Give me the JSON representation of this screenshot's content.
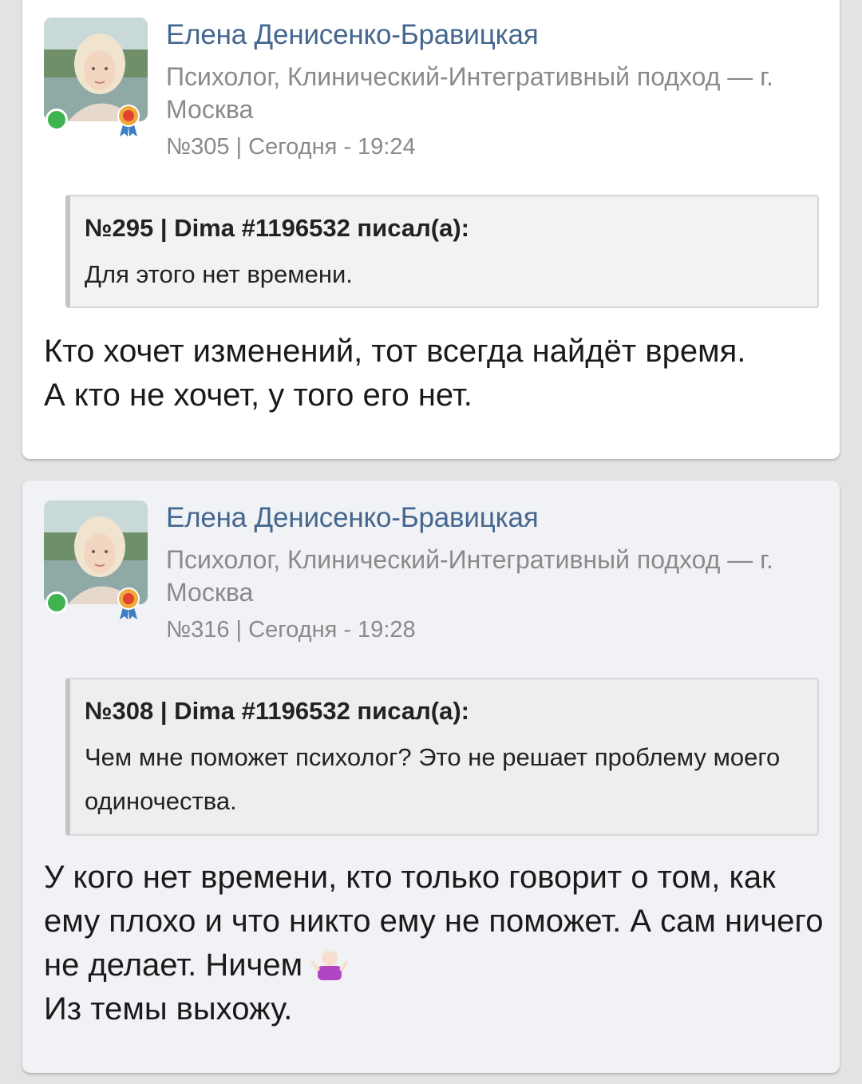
{
  "posts": [
    {
      "author": "Елена Денисенко-Бравицкая",
      "role": "Психолог, Клинический-Интегративный подход — г. Москва",
      "meta": "№305 | Сегодня - 19:24",
      "quote": {
        "header": "№295 | Dima #1196532 писал(а):",
        "text": "Для этого нет времени."
      },
      "body": "Кто хочет изменений, тот всегда найдёт время.\nА кто не хочет, у того его нет."
    },
    {
      "author": "Елена Денисенко-Бравицкая",
      "role": "Психолог, Клинический-Интегративный подход — г. Москва",
      "meta": "№316 | Сегодня - 19:28",
      "quote": {
        "header": "№308 | Dima #1196532 писал(а):",
        "text": "Чем мне поможет психолог? Это не решает проблему моего одиночества."
      },
      "body_line1": "У кого нет времени, кто только говорит о том, как ему плохо и что никто ему не поможет. А сам ничего не делает. Ничем",
      "body_emoji": "person-shrugging-emoji",
      "body_line2": "Из темы выхожу."
    }
  ],
  "colors": {
    "author": "#45678f",
    "online": "#3fb34f",
    "background": "#e3e3e3"
  }
}
